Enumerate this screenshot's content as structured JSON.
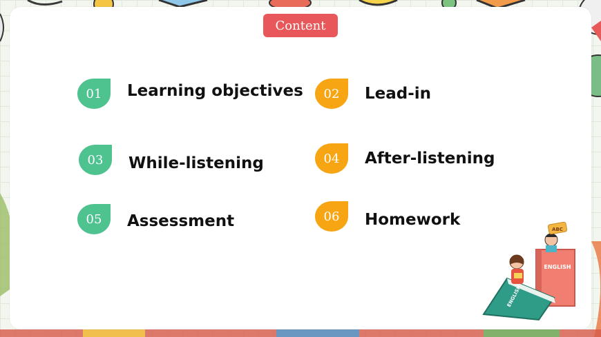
{
  "header": {
    "badge_label": "Content"
  },
  "items": [
    {
      "num": "01",
      "label": "Learning objectives",
      "color": "#4ec28f"
    },
    {
      "num": "02",
      "label": "Lead-in",
      "color": "#f7a513"
    },
    {
      "num": "03",
      "label": "While-listening",
      "color": "#4ec28f"
    },
    {
      "num": "04",
      "label": "After-listening",
      "color": "#f7a513"
    },
    {
      "num": "05",
      "label": "Assessment",
      "color": "#4ec28f"
    },
    {
      "num": "06",
      "label": "Homework",
      "color": "#f7a513"
    }
  ],
  "illustration": {
    "book_front": "ENGLISH",
    "book_back": "ENGLISH",
    "sign": "ABC"
  },
  "colors": {
    "badge": "#e8575a",
    "green": "#4ec28f",
    "orange": "#f7a513"
  }
}
